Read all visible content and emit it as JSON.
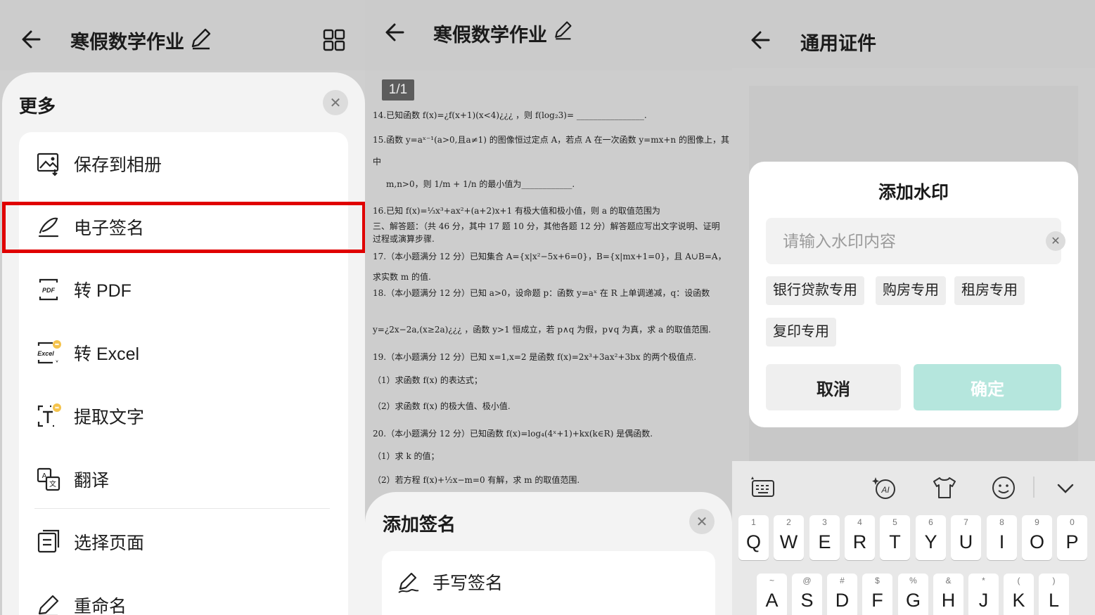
{
  "panel1": {
    "title": "寒假数学作业",
    "sheet_title": "更多",
    "menu": [
      {
        "label": "保存到相册",
        "icon": "image-save-icon"
      },
      {
        "label": "电子签名",
        "icon": "signature-icon"
      },
      {
        "label": "转 PDF",
        "icon": "pdf-icon"
      },
      {
        "label": "转 Excel",
        "icon": "excel-icon"
      },
      {
        "label": "提取文字",
        "icon": "extract-text-icon"
      },
      {
        "label": "翻译",
        "icon": "translate-icon"
      },
      {
        "label": "选择页面",
        "icon": "select-page-icon"
      },
      {
        "label": "重命名",
        "icon": "rename-icon"
      }
    ]
  },
  "panel2": {
    "title": "寒假数学作业",
    "page_indicator": "1/1",
    "doc_lines": [
      "14.已知函数 f(x)=¿f(x+1)(x<4)¿¿¿ ，则 f(log₂3)= ________________.",
      "15.函数 y=aˣ⁻¹(a>0,且a≠1) 的图像恒过定点 A，若点 A 在一次函数 y=mx+n 的图像上，其",
      "中",
      "m,n>0，则 1/m + 1/n 的最小值为____________.",
      "16.已知 f(x)=⅓x³+ax²+(a+2)x+1 有极大值和极小值，则 a 的取值范围为",
      "三、解答题：（共 46 分，其中 17 题 10 分，其他各题 12 分）解答题应写出文字说明、证明",
      "过程或演算步骤.",
      "17.（本小题满分 12 分）已知集合 A={x|x²−5x+6=0}，B={x|mx+1=0}，且 A∪B=A，",
      "求实数 m 的值.",
      "18.（本小题满分 12 分）已知 a>0，设命题 p：函数 y=aˣ 在 R 上单调递减，q：设函数",
      "y=¿2x−2a,(x≥2a)¿¿¿ ，函数 y>1 恒成立，若 p∧q 为假，p∨q 为真，求 a 的取值范围.",
      "19.（本小题满分 12 分）已知 x=1,x=2 是函数 f(x)=2x³+3ax²+3bx 的两个极值点.",
      "（1）求函数 f(x) 的表达式；",
      "（2）求函数 f(x) 的极大值、极小值.",
      "20.（本小题满分 12 分）已知函数 f(x)=log₄(4ˣ+1)+kx(k∈R) 是偶函数.",
      "（1）求 k 的值；",
      "（2）若方程 f(x)+½x−m=0 有解，求 m 的取值范围."
    ],
    "sheet_title": "添加签名",
    "option": "手写签名"
  },
  "panel3": {
    "title": "通用证件",
    "dialog_title": "添加水印",
    "input_placeholder": "请输入水印内容",
    "chips": [
      "银行贷款专用",
      "购房专用",
      "租房专用",
      "复印专用"
    ],
    "cancel": "取消",
    "confirm": "确定",
    "keyboard_row1": [
      {
        "k": "Q",
        "s": "1"
      },
      {
        "k": "W",
        "s": "2"
      },
      {
        "k": "E",
        "s": "3"
      },
      {
        "k": "R",
        "s": "4"
      },
      {
        "k": "T",
        "s": "5"
      },
      {
        "k": "Y",
        "s": "6"
      },
      {
        "k": "U",
        "s": "7"
      },
      {
        "k": "I",
        "s": "8"
      },
      {
        "k": "O",
        "s": "9"
      },
      {
        "k": "P",
        "s": "0"
      }
    ],
    "keyboard_row2": [
      {
        "k": "A",
        "s": "~"
      },
      {
        "k": "S",
        "s": "@"
      },
      {
        "k": "D",
        "s": "#"
      },
      {
        "k": "F",
        "s": "$"
      },
      {
        "k": "G",
        "s": "%"
      },
      {
        "k": "H",
        "s": "&"
      },
      {
        "k": "J",
        "s": "*"
      },
      {
        "k": "K",
        "s": "("
      },
      {
        "k": "L",
        "s": ")"
      }
    ]
  },
  "colors": {
    "highlight": "#e00000",
    "confirm_disabled": "#b5e6dd"
  }
}
